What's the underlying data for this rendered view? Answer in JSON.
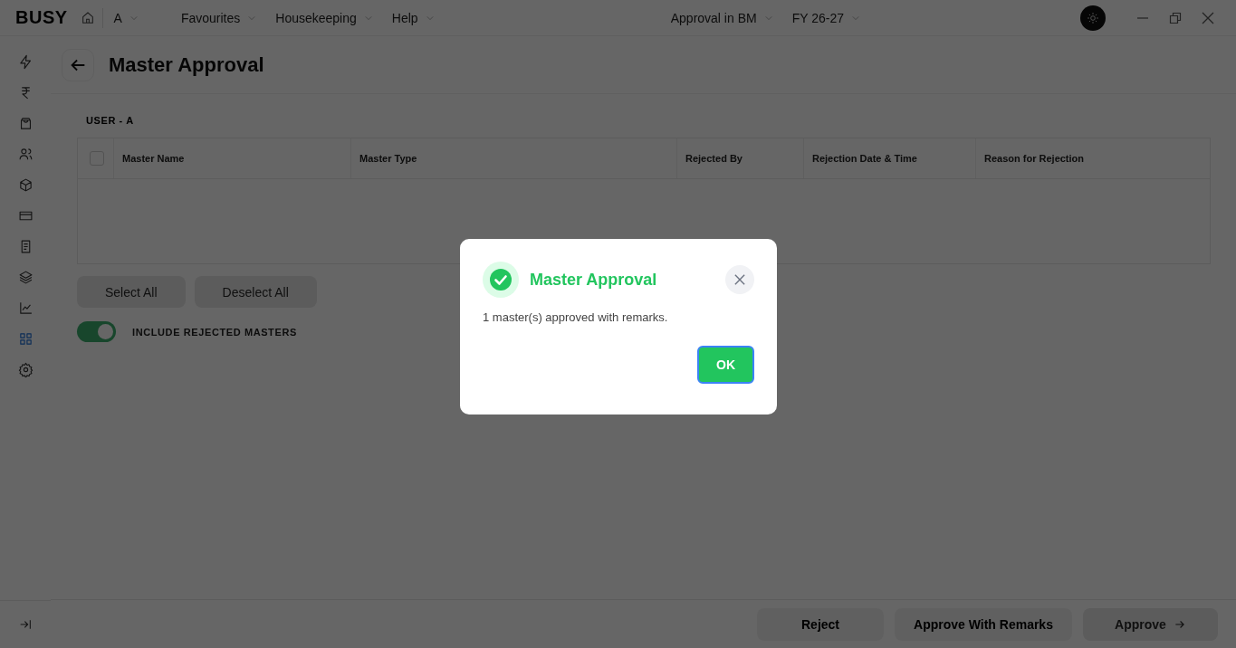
{
  "app": {
    "logo": "BUSY"
  },
  "user_menu": {
    "label": "A"
  },
  "top_menu": [
    {
      "label": "Favourites"
    },
    {
      "label": "Housekeeping"
    },
    {
      "label": "Help"
    }
  ],
  "company": "Approval in BM",
  "financial_year": "FY 26-27",
  "sidebar": {
    "items": [
      {
        "kind": "bolt",
        "selected": false
      },
      {
        "kind": "rupee",
        "selected": false
      },
      {
        "kind": "bag",
        "selected": false
      },
      {
        "kind": "users",
        "selected": false
      },
      {
        "kind": "box",
        "selected": false
      },
      {
        "kind": "card",
        "selected": false
      },
      {
        "kind": "document",
        "selected": false
      },
      {
        "kind": "layers",
        "selected": false
      },
      {
        "kind": "chart",
        "selected": false
      },
      {
        "kind": "grid",
        "selected": true
      },
      {
        "kind": "gear",
        "selected": false
      }
    ]
  },
  "page": {
    "title": "Master Approval",
    "user_label": "USER - A"
  },
  "table": {
    "select_all_checked": false,
    "columns": [
      "Master Name",
      "Master Type",
      "Rejected By",
      "Rejection Date & Time",
      "Reason for Rejection"
    ]
  },
  "buttons": [
    {
      "label": "Select All",
      "disabled": true
    },
    {
      "label": "Deselect All",
      "disabled": true
    }
  ],
  "toggle": {
    "label": "INCLUDE REJECTED MASTERS",
    "on": true
  },
  "footer_buttons": [
    {
      "label": "Reject",
      "disabled": false,
      "arrow": false
    },
    {
      "label": "Approve With Remarks",
      "disabled": false,
      "arrow": false
    },
    {
      "label": "Approve",
      "disabled": true,
      "arrow": true
    }
  ],
  "dialog": {
    "title": "Master Approval",
    "message": "1 master(s) approved with remarks.",
    "ok": "OK"
  }
}
